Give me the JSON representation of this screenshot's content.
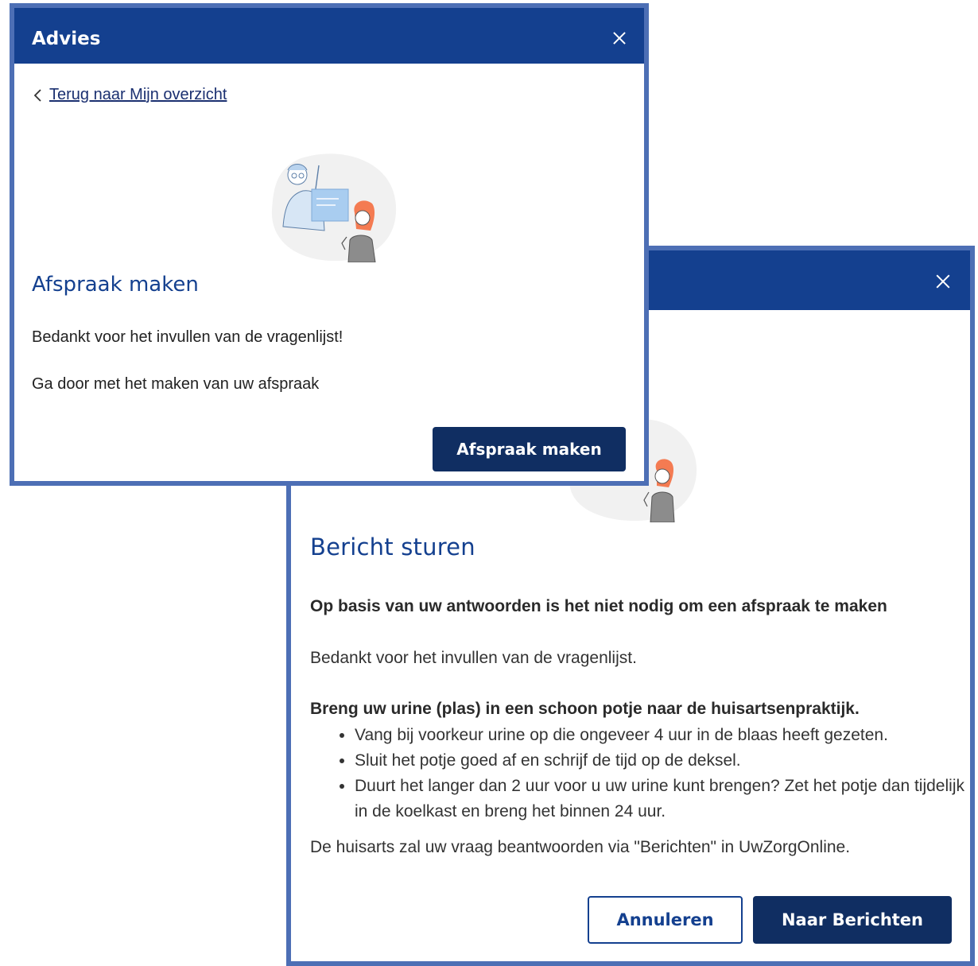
{
  "dialog_back": {
    "title": "Bericht sturen",
    "intro": "Op basis van uw antwoorden is het niet nodig om een afspraak te maken",
    "thanks": "Bedankt voor het invullen van de vragenlijst.",
    "instructions_title": "Breng uw urine (plas) in een schoon potje naar de huisartsenpraktijk.",
    "instructions": [
      "Vang bij voorkeur urine op die ongeveer 4 uur in de blaas heeft gezeten.",
      "Sluit het potje goed af en schrijf de tijd op de deksel.",
      "Duurt het langer dan 2 uur voor u uw urine kunt brengen? Zet het potje dan tijdelijk in de koelkast en breng het binnen 24 uur."
    ],
    "footer_note": "De huisarts zal uw vraag beantwoorden via \"Berichten\" in UwZorgOnline.",
    "cancel_label": "Annuleren",
    "primary_label": "Naar Berichten"
  },
  "dialog_front": {
    "header_title": "Advies",
    "back_link": "Terug naar Mijn overzicht",
    "title": "Afspraak maken",
    "text1": "Bedankt voor het invullen van de vragenlijst!",
    "text2": "Ga door met het maken van uw afspraak",
    "primary_label": "Afspraak maken"
  },
  "colors": {
    "header": "#14408f",
    "border": "#4d6fb5",
    "button": "#102e62",
    "heading": "#14408f"
  },
  "icons": [
    "close-icon",
    "chevron-left-icon",
    "consultation-illustration"
  ]
}
